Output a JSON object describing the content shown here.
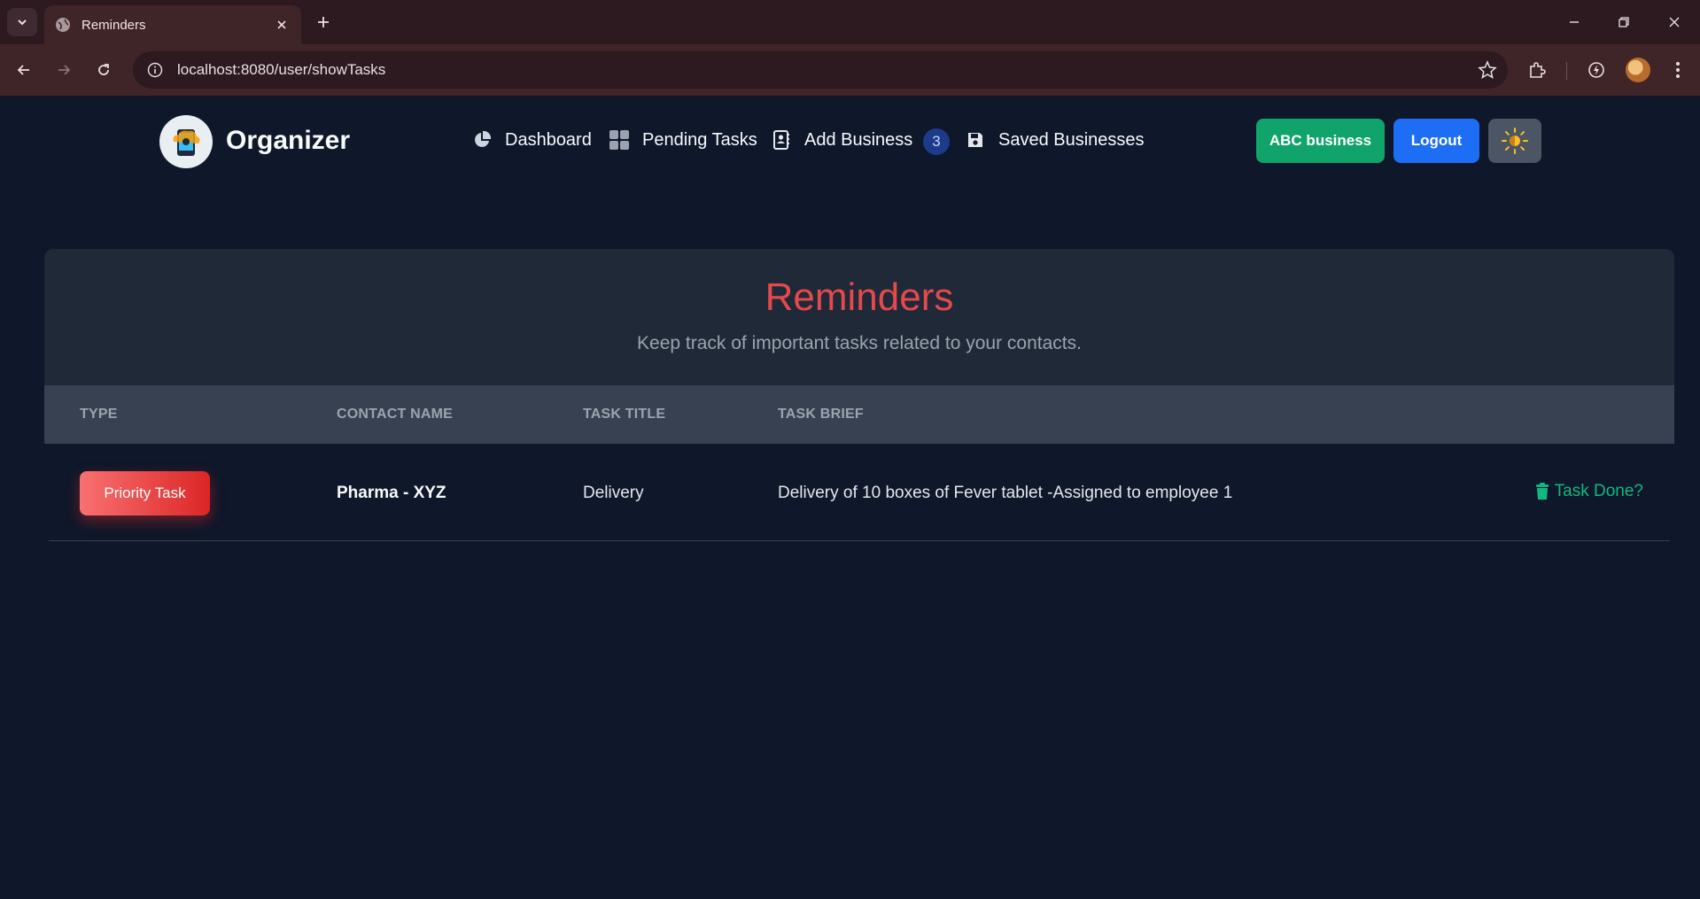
{
  "browser": {
    "tab_title": "Reminders",
    "url": "localhost:8080/user/showTasks"
  },
  "app": {
    "brand": "Organizer",
    "nav": [
      {
        "label": "Dashboard",
        "icon": "pie-chart-icon"
      },
      {
        "label": "Pending Tasks",
        "icon": "grid-icon"
      },
      {
        "label": "Add Business",
        "icon": "address-book-icon"
      },
      {
        "label": "Saved Businesses",
        "icon": "floppy-disk-icon"
      }
    ],
    "badge_count": "3",
    "business_button": "ABC business",
    "logout_button": "Logout",
    "theme_icon": "sun-icon"
  },
  "page": {
    "title": "Reminders",
    "subtitle": "Keep track of important tasks related to your contacts."
  },
  "table": {
    "headers": [
      "TYPE",
      "CONTACT NAME",
      "TASK TITLE",
      "TASK BRIEF"
    ],
    "rows": [
      {
        "type": "Priority Task",
        "contact": "Pharma - XYZ",
        "title": "Delivery",
        "brief": "Delivery of 10 boxes of Fever tablet -Assigned to employee 1",
        "action": "Task Done?"
      }
    ]
  },
  "colors": {
    "background": "#0f172a",
    "title_red": "#e5484d",
    "success_green": "#10a36b",
    "primary_blue": "#1d6ef5"
  }
}
